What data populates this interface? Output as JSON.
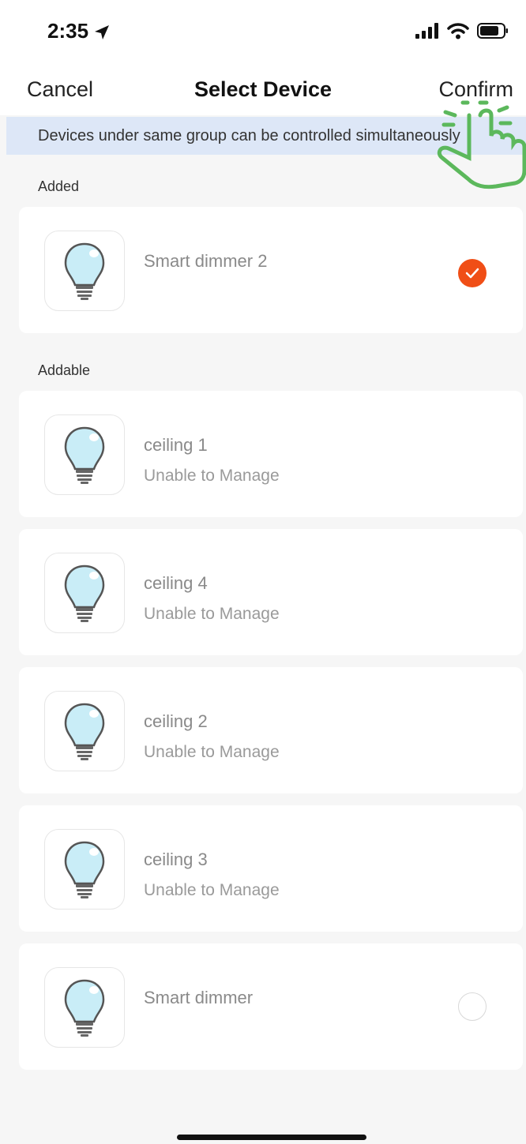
{
  "status_bar": {
    "time": "2:35"
  },
  "nav": {
    "cancel": "Cancel",
    "title": "Select Device",
    "confirm": "Confirm"
  },
  "banner": {
    "text": "Devices under same group can be controlled simultaneously"
  },
  "sections": {
    "added": "Added",
    "addable": "Addable"
  },
  "added_devices": [
    {
      "name": "Smart dimmer 2",
      "selected": true,
      "icon": "lightbulb-icon"
    }
  ],
  "addable_devices": [
    {
      "name": "ceiling 1",
      "status": "Unable to Manage",
      "icon": "lightbulb-icon"
    },
    {
      "name": "ceiling 4",
      "status": "Unable to Manage",
      "icon": "lightbulb-icon"
    },
    {
      "name": "ceiling 2",
      "status": "Unable to Manage",
      "icon": "lightbulb-icon"
    },
    {
      "name": "ceiling 3",
      "status": "Unable to Manage",
      "icon": "lightbulb-icon"
    },
    {
      "name": "Smart dimmer",
      "selected": false,
      "icon": "lightbulb-icon"
    }
  ],
  "colors": {
    "accent": "#f04e16",
    "banner_bg": "#dde7f7",
    "tap_hint": "#5cb85c"
  }
}
